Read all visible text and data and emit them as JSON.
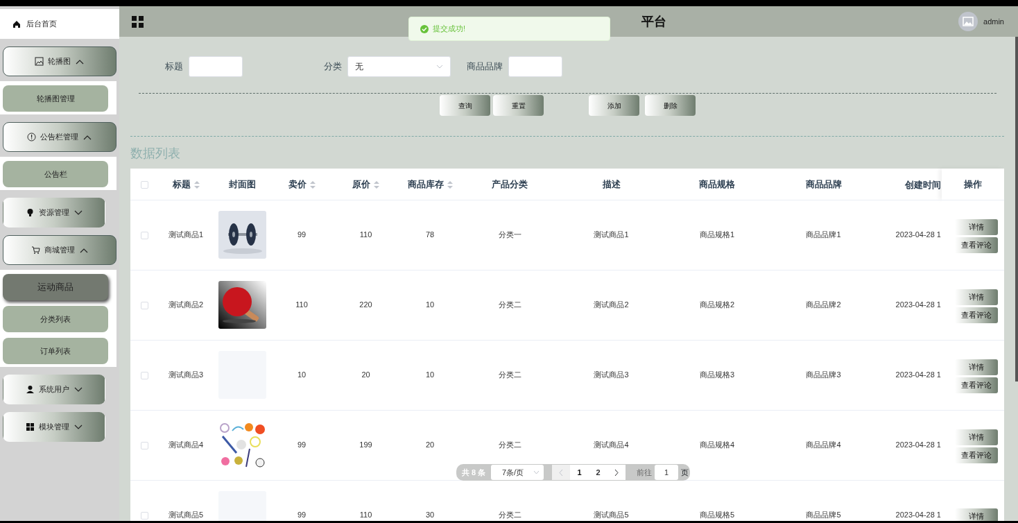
{
  "sidebar": {
    "home": {
      "label": "后台首页"
    },
    "groups": [
      {
        "label": "轮播图",
        "expanded": true,
        "items": [
          {
            "label": "轮播图管理",
            "selected": false
          }
        ]
      },
      {
        "label": "公告栏管理",
        "expanded": true,
        "items": [
          {
            "label": "公告栏",
            "selected": false
          }
        ]
      },
      {
        "label": "资源管理",
        "expanded": false
      },
      {
        "label": "商城管理",
        "expanded": true,
        "items": [
          {
            "label": "运动商品",
            "selected": true
          },
          {
            "label": "分类列表",
            "selected": false
          },
          {
            "label": "订单列表",
            "selected": false
          }
        ]
      },
      {
        "label": "系统用户",
        "expanded": false
      },
      {
        "label": "模块管理",
        "expanded": false
      }
    ]
  },
  "header": {
    "title": "平台",
    "user": "admin"
  },
  "toast": {
    "message": "提交成功!"
  },
  "search": {
    "fields": [
      {
        "kind": "input",
        "label": "标题"
      },
      {
        "kind": "select",
        "label": "分类",
        "value": "无"
      },
      {
        "kind": "input",
        "label": "商品品牌"
      }
    ],
    "buttons": [
      "查询",
      "重置",
      "添加",
      "删除"
    ]
  },
  "section_title": "数据列表",
  "table": {
    "all_selected": false,
    "columns": [
      {
        "label": "标题",
        "sortable": true
      },
      {
        "label": "封面图",
        "sortable": false
      },
      {
        "label": "卖价",
        "sortable": true
      },
      {
        "label": "原价",
        "sortable": true
      },
      {
        "label": "商品库存",
        "sortable": true
      },
      {
        "label": "产品分类",
        "sortable": false
      },
      {
        "label": "描述",
        "sortable": false
      },
      {
        "label": "商品规格",
        "sortable": false
      },
      {
        "label": "商品品牌",
        "sortable": false
      },
      {
        "label": "创建时间",
        "sortable": false
      },
      {
        "label": "操作",
        "sortable": false
      }
    ],
    "rows": [
      {
        "selected": false,
        "title": "测试商品1",
        "cover": {
          "kind": "dumbbell"
        },
        "price": "99",
        "original": "110",
        "stock": "78",
        "category": "分类一",
        "desc": "测试商品1",
        "spec": "商品规格1",
        "brand": "商品品牌1",
        "created": "2023-04-28 1",
        "actions": [
          "详情",
          "查看评论"
        ]
      },
      {
        "selected": false,
        "title": "测试商品2",
        "cover": {
          "kind": "paddle"
        },
        "price": "110",
        "original": "220",
        "stock": "10",
        "category": "分类二",
        "desc": "测试商品2",
        "spec": "商品规格2",
        "brand": "商品品牌2",
        "created": "2023-04-28 1",
        "actions": [
          "详情",
          "查看评论"
        ]
      },
      {
        "selected": false,
        "title": "测试商品3",
        "cover": {
          "kind": "empty"
        },
        "price": "10",
        "original": "20",
        "stock": "10",
        "category": "分类二",
        "desc": "测试商品3",
        "spec": "商品规格3",
        "brand": "商品品牌3",
        "created": "2023-04-28 1",
        "actions": [
          "详情",
          "查看评论"
        ]
      },
      {
        "selected": false,
        "title": "测试商品4",
        "cover": {
          "kind": "sports"
        },
        "price": "99",
        "original": "199",
        "stock": "20",
        "category": "分类二",
        "desc": "测试商品4",
        "spec": "商品规格4",
        "brand": "商品品牌4",
        "created": "2023-04-28 1",
        "actions": [
          "详情",
          "查看评论"
        ]
      },
      {
        "selected": false,
        "title": "测试商品5",
        "cover": {
          "kind": "empty"
        },
        "price": "99",
        "original": "110",
        "stock": "30",
        "category": "分类二",
        "desc": "测试商品5",
        "spec": "商品规格5",
        "brand": "商品品牌5",
        "created": "2023-04-28 1",
        "actions": [
          "详情"
        ]
      }
    ]
  },
  "pagination": {
    "total": "共 8 条",
    "page_size": "7条/页",
    "prev_disabled": true,
    "pages": [
      {
        "label": "1",
        "selected": true
      },
      {
        "label": "2",
        "selected": false
      }
    ],
    "goto_label": "前往",
    "goto_value": "1",
    "goto_suffix": "页"
  }
}
